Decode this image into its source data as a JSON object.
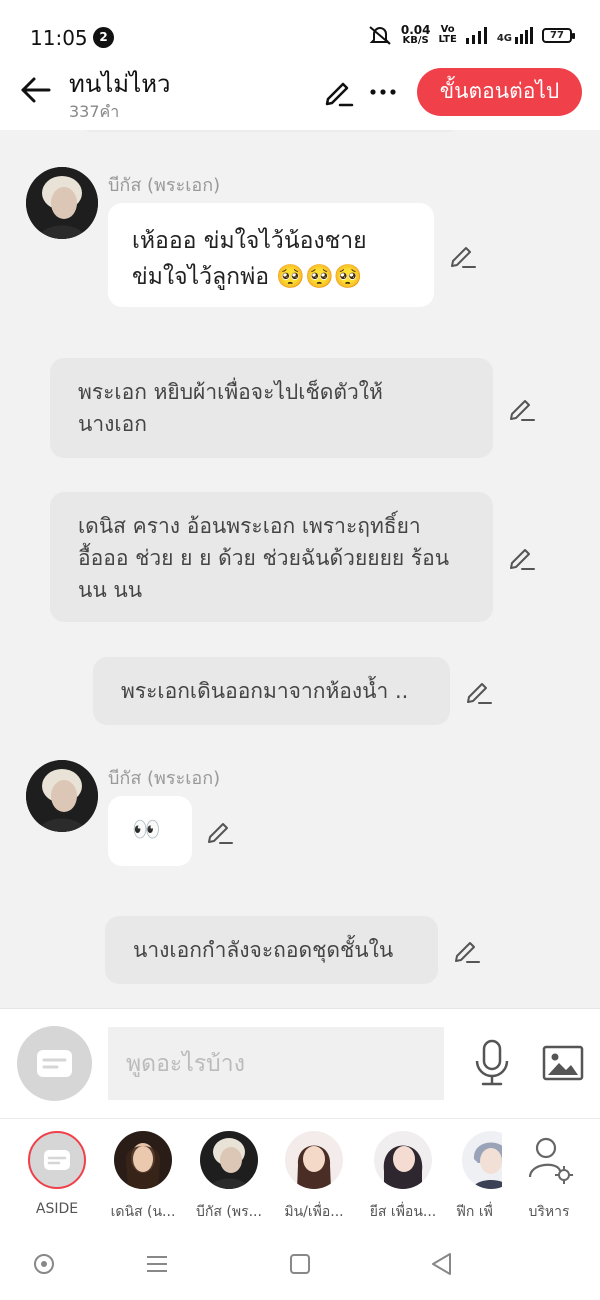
{
  "status_bar": {
    "time": "11:05",
    "notification_count": "2",
    "net_speed_value": "0.04",
    "net_speed_unit": "KB/S",
    "volte_top": "Vo",
    "volte_bottom": "LTE",
    "network_label": "4G",
    "battery": "77"
  },
  "header": {
    "title": "ทนไม่ไหว",
    "word_count": "337คำ",
    "next_step_label": "ขั้นตอนต่อไป",
    "accent_color": "#f0404a"
  },
  "chat": {
    "messages": [
      {
        "type": "character",
        "speaker": "บีกัส (พระเอก)",
        "lines": [
          "เห้อออ ข่มใจไว้น้องชาย",
          "ข่มใจไว้ลูกพ่อ 🥺🥺🥺"
        ]
      },
      {
        "type": "narration",
        "lines": [
          "พระเอก หยิบผ้าเพื่อจะไปเช็ดตัวให้",
          "นางเอก"
        ]
      },
      {
        "type": "narration",
        "lines": [
          "เดนิส คราง อ้อนพระเอก เพราะฤทธิ์ยา",
          "อื้อออ ช่วย ย ย ด้วย ช่วยฉันด้วยยยย ร้อน",
          "นน นน"
        ]
      },
      {
        "type": "narration",
        "lines": [
          "พระเอกเดินออกมาจากห้องน้ำ .."
        ]
      },
      {
        "type": "character",
        "speaker": "บีกัส (พระเอก)",
        "lines": [
          "👀"
        ]
      },
      {
        "type": "narration",
        "lines": [
          "นางเอกกำลังจะถอดชุดชั้นใน"
        ]
      }
    ]
  },
  "input": {
    "placeholder": "พูดอะไรบ้าง"
  },
  "characters": [
    {
      "label": "ASIDE"
    },
    {
      "label": "เดนิส (น..."
    },
    {
      "label": "บีกัส (พร..."
    },
    {
      "label": "มิน/เพื่อ..."
    },
    {
      "label": "ยีส เพื่อน..."
    },
    {
      "label": "ฟีก เพื่"
    },
    {
      "label": "บริหาร"
    }
  ]
}
